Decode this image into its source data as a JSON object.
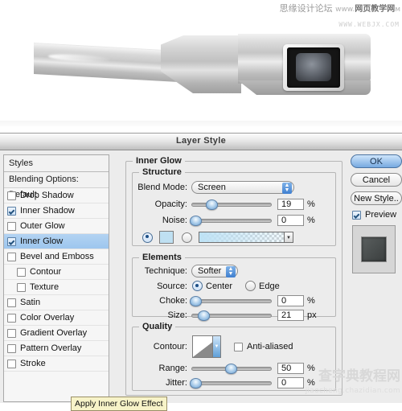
{
  "watermarks": {
    "top_cn": "思缘设计论坛",
    "top_url_prefix": "www.",
    "top_url": "网页教学网",
    "top_url_suffix": "м",
    "photo_url": "WWW.WEBJX.COM",
    "bottom_cn": "查字典教程网",
    "bottom_url": "jiaocheng.chazidian.com"
  },
  "photo": {
    "alt": "metallic-device-render"
  },
  "dialog": {
    "title": "Layer Style",
    "styles_panel": {
      "header": "Styles",
      "blending_options": "Blending Options: Default",
      "items": [
        {
          "label": "Drop Shadow",
          "checked": false,
          "indent": false,
          "selected": false
        },
        {
          "label": "Inner Shadow",
          "checked": true,
          "indent": false,
          "selected": false
        },
        {
          "label": "Outer Glow",
          "checked": false,
          "indent": false,
          "selected": false
        },
        {
          "label": "Inner Glow",
          "checked": true,
          "indent": false,
          "selected": true
        },
        {
          "label": "Bevel and Emboss",
          "checked": false,
          "indent": false,
          "selected": false
        },
        {
          "label": "Contour",
          "checked": false,
          "indent": true,
          "selected": false
        },
        {
          "label": "Texture",
          "checked": false,
          "indent": true,
          "selected": false
        },
        {
          "label": "Satin",
          "checked": false,
          "indent": false,
          "selected": false
        },
        {
          "label": "Color Overlay",
          "checked": false,
          "indent": false,
          "selected": false
        },
        {
          "label": "Gradient Overlay",
          "checked": false,
          "indent": false,
          "selected": false
        },
        {
          "label": "Pattern Overlay",
          "checked": false,
          "indent": false,
          "selected": false
        },
        {
          "label": "Stroke",
          "checked": false,
          "indent": false,
          "selected": false
        }
      ]
    },
    "tooltip": "Apply Inner Glow Effect",
    "inner_glow": {
      "group_label": "Inner Glow",
      "structure": {
        "label": "Structure",
        "blend_mode_label": "Blend Mode:",
        "blend_mode_value": "Screen",
        "opacity_label": "Opacity:",
        "opacity_value": "19",
        "opacity_unit": "%",
        "noise_label": "Noise:",
        "noise_value": "0",
        "noise_unit": "%",
        "fill_type": "gradient",
        "color_swatch_hex": "#bfe0f2",
        "gradient_hex": "#bee2f5"
      },
      "elements": {
        "label": "Elements",
        "technique_label": "Technique:",
        "technique_value": "Softer",
        "source_label": "Source:",
        "source_center": "Center",
        "source_edge": "Edge",
        "source_selected": "Center",
        "choke_label": "Choke:",
        "choke_value": "0",
        "choke_unit": "%",
        "size_label": "Size:",
        "size_value": "21",
        "size_unit": "px"
      },
      "quality": {
        "label": "Quality",
        "contour_label": "Contour:",
        "anti_aliased_label": "Anti-aliased",
        "anti_aliased_checked": false,
        "range_label": "Range:",
        "range_value": "50",
        "range_unit": "%",
        "jitter_label": "Jitter:",
        "jitter_value": "0",
        "jitter_unit": "%"
      }
    },
    "actions": {
      "ok": "OK",
      "cancel": "Cancel",
      "new_style": "New Style..",
      "preview_label": "Preview",
      "preview_checked": true
    }
  }
}
